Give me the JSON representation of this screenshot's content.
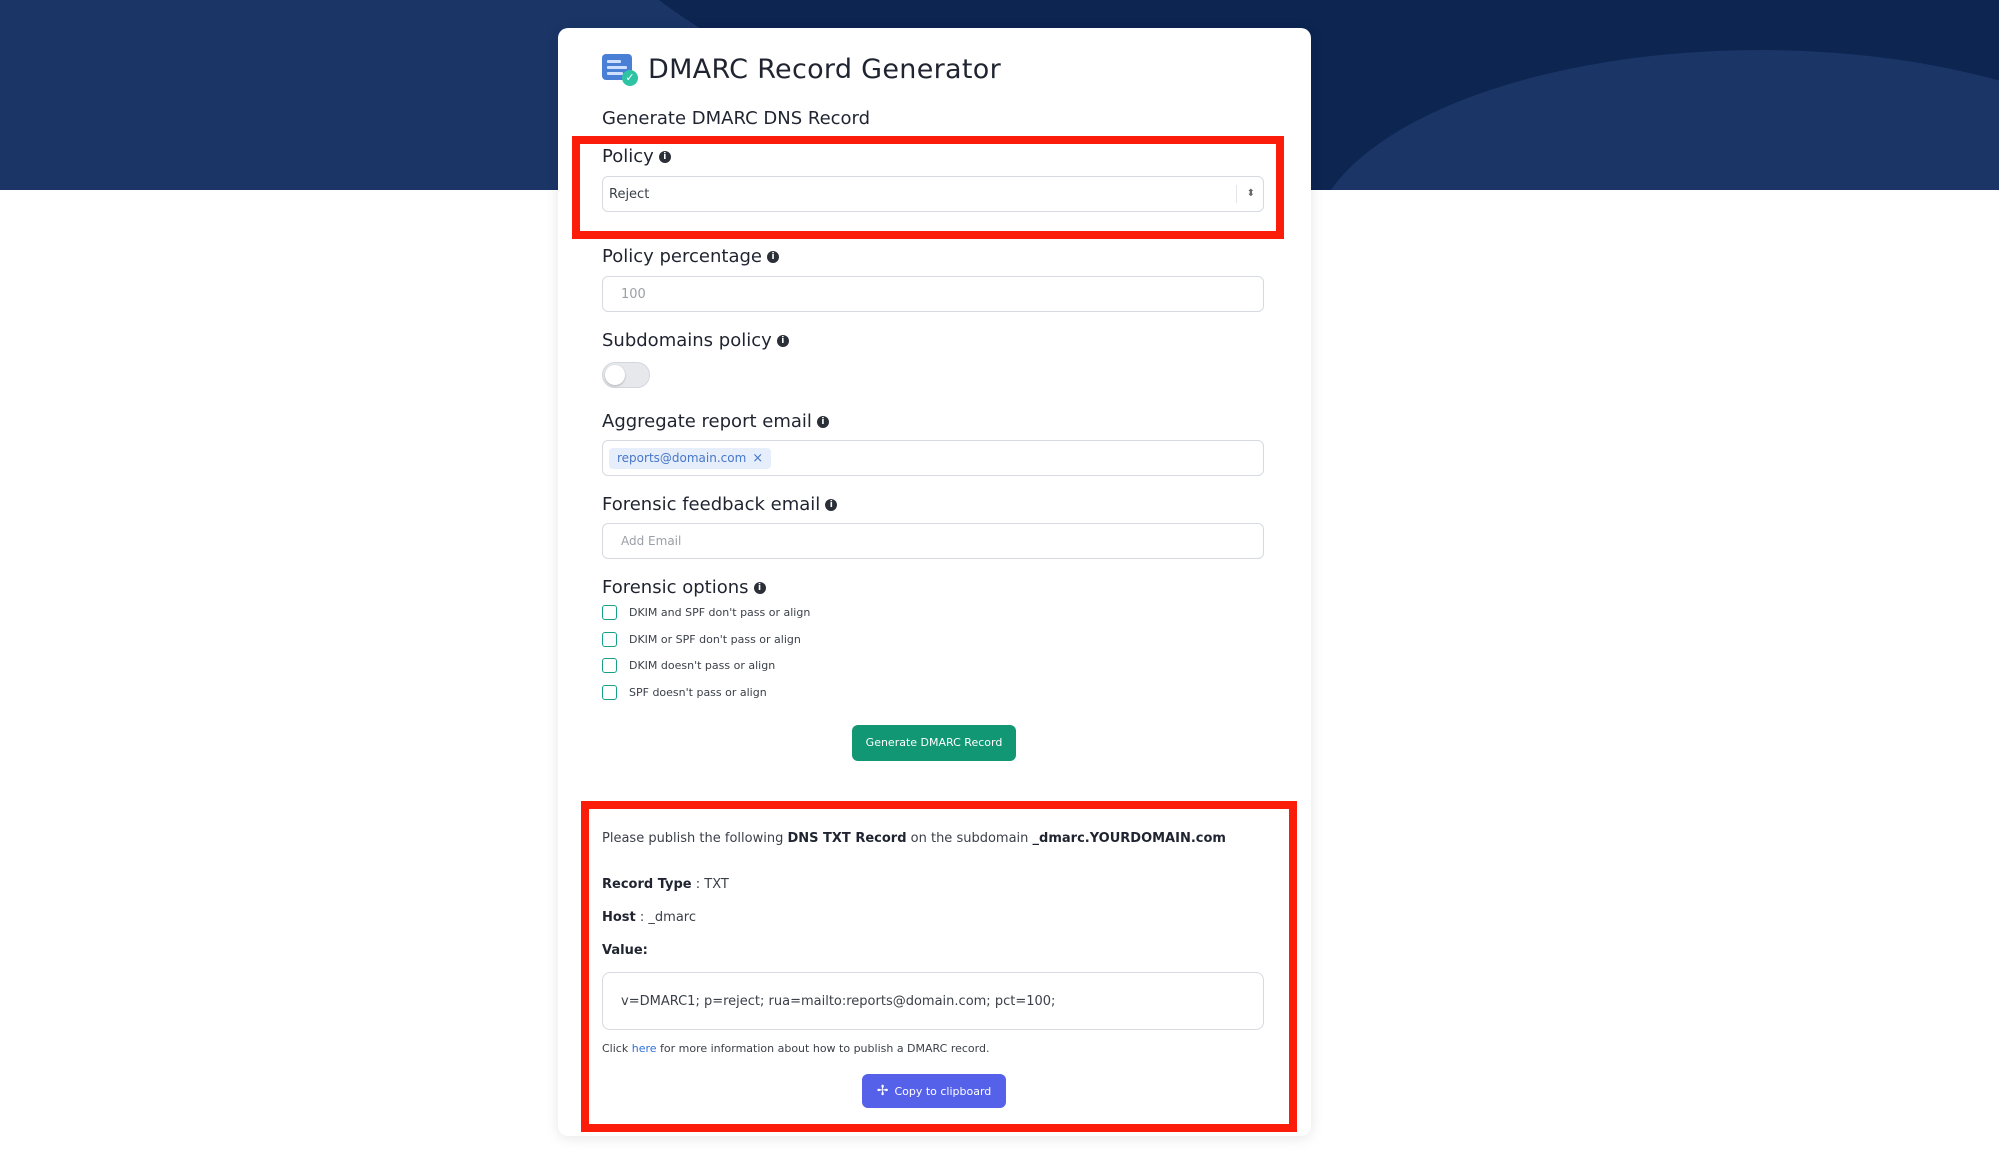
{
  "header": {
    "title": "DMARC Record Generator",
    "subtitle": "Generate DMARC DNS Record"
  },
  "policy": {
    "label": "Policy",
    "value": "Reject"
  },
  "policy_percentage": {
    "label": "Policy percentage",
    "placeholder": "100"
  },
  "subdomains_policy": {
    "label": "Subdomains policy",
    "enabled": false
  },
  "aggregate_report_email": {
    "label": "Aggregate report email",
    "tags": [
      "reports@domain.com"
    ],
    "remove_glyph": "×"
  },
  "forensic_feedback_email": {
    "label": "Forensic feedback email",
    "placeholder": "Add Email"
  },
  "forensic_options": {
    "label": "Forensic options",
    "items": [
      "DKIM and SPF don't pass or align",
      "DKIM or SPF don't pass or align",
      "DKIM doesn't pass or align",
      "SPF doesn't pass or align"
    ]
  },
  "generate_button": "Generate DMARC Record",
  "result": {
    "intro_prefix": "Please publish the following ",
    "intro_bold1": "DNS TXT Record",
    "intro_mid": " on the subdomain ",
    "intro_bold2": "_dmarc.YOURDOMAIN.com",
    "record_type_label": "Record Type",
    "record_type_value": "TXT",
    "host_label": "Host",
    "host_value": "_dmarc",
    "value_label": "Value:",
    "value": "v=DMARC1; p=reject; rua=mailto:reports@domain.com; pct=100;",
    "help_prefix": "Click ",
    "help_link": "here",
    "help_suffix": " for more information about how to publish a DMARC record.",
    "copy_button": "Copy to clipboard"
  },
  "colors": {
    "accent_green": "#119773",
    "accent_blue": "#5561e8",
    "highlight_red": "#fb1c0a",
    "header_navy": "#1a3566"
  },
  "icons": [
    "dmarc-logo-icon",
    "info-icon",
    "select-arrow-icon",
    "close-icon",
    "plus-icon"
  ]
}
